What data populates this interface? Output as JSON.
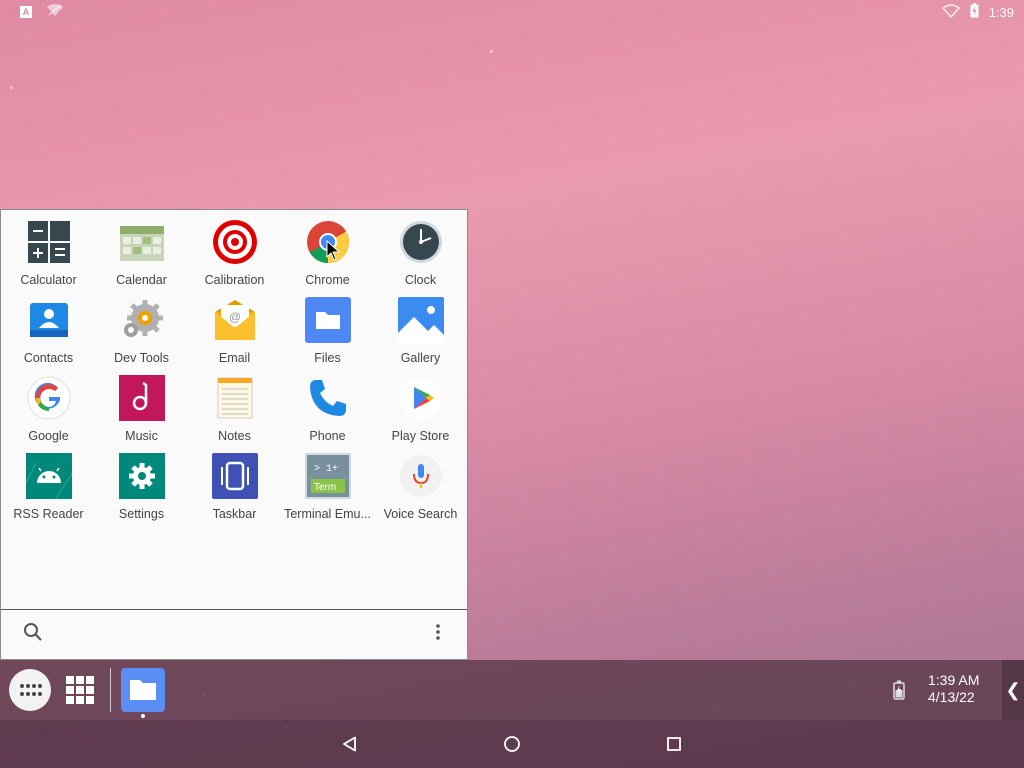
{
  "status_bar": {
    "notification_letter": "A",
    "time": "1:39",
    "icons": [
      "a-notification-icon",
      "wifi-crossed-icon",
      "wifi-icon",
      "battery-charging-icon"
    ]
  },
  "drawer": {
    "apps": [
      {
        "label": "Calculator",
        "icon": "calculator-icon"
      },
      {
        "label": "Calendar",
        "icon": "calendar-icon"
      },
      {
        "label": "Calibration",
        "icon": "target-icon"
      },
      {
        "label": "Chrome",
        "icon": "chrome-icon"
      },
      {
        "label": "Clock",
        "icon": "clock-icon"
      },
      {
        "label": "Contacts",
        "icon": "contacts-icon"
      },
      {
        "label": "Dev Tools",
        "icon": "gear-icon"
      },
      {
        "label": "Email",
        "icon": "envelope-icon"
      },
      {
        "label": "Files",
        "icon": "folder-icon"
      },
      {
        "label": "Gallery",
        "icon": "picture-icon"
      },
      {
        "label": "Google",
        "icon": "google-icon"
      },
      {
        "label": "Music",
        "icon": "music-icon"
      },
      {
        "label": "Notes",
        "icon": "notepad-icon"
      },
      {
        "label": "Phone",
        "icon": "phone-icon"
      },
      {
        "label": "Play Store",
        "icon": "play-store-icon"
      },
      {
        "label": "RSS Reader",
        "icon": "android-icon"
      },
      {
        "label": "Settings",
        "icon": "settings-icon"
      },
      {
        "label": "Taskbar",
        "icon": "taskbar-icon"
      },
      {
        "label": "Terminal Emu...",
        "icon": "terminal-icon"
      },
      {
        "label": "Voice Search",
        "icon": "microphone-icon"
      }
    ],
    "terminal_icon_text": [
      "> 1+",
      "Term"
    ]
  },
  "taskbar": {
    "time": "1:39 AM",
    "date": "4/13/22",
    "collapse_glyph": "❮",
    "pinned": [
      {
        "name": "Files",
        "icon": "folder-icon"
      }
    ]
  },
  "colors": {
    "wallpaper": "#e396ab",
    "taskbar": "#5a3a4a",
    "files_blue": "#4d88f5"
  }
}
